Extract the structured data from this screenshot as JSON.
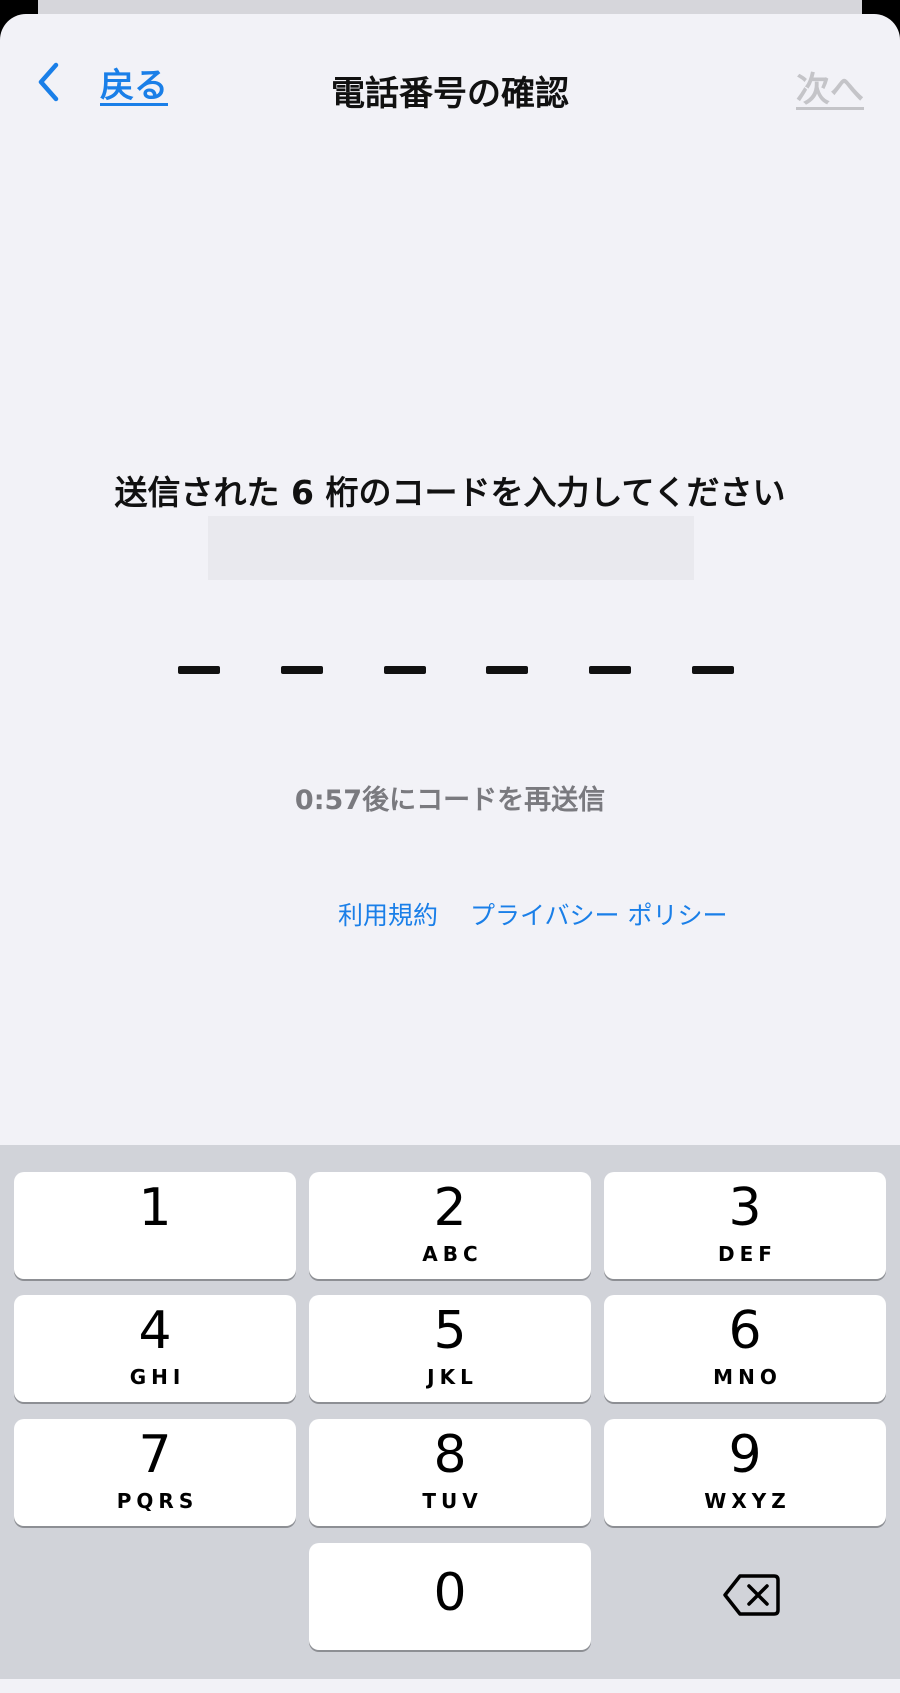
{
  "nav": {
    "back_label": "戻る",
    "title": "電話番号の確認",
    "next_label": "次へ"
  },
  "verification": {
    "instruction": "送信された 6 桁のコードを入力してください",
    "code_length": 6,
    "resend_text": "0:57後にコードを再送信"
  },
  "links": {
    "terms": "利用規約",
    "privacy": "プライバシー ポリシー"
  },
  "keypad": {
    "keys": [
      {
        "digit": "1",
        "letters": ""
      },
      {
        "digit": "2",
        "letters": "ABC"
      },
      {
        "digit": "3",
        "letters": "DEF"
      },
      {
        "digit": "4",
        "letters": "GHI"
      },
      {
        "digit": "5",
        "letters": "JKL"
      },
      {
        "digit": "6",
        "letters": "MNO"
      },
      {
        "digit": "7",
        "letters": "PQRS"
      },
      {
        "digit": "8",
        "letters": "TUV"
      },
      {
        "digit": "9",
        "letters": "WXYZ"
      },
      {
        "digit": "0",
        "letters": ""
      }
    ]
  },
  "icons": {
    "back": "chevron-left-icon",
    "delete": "backspace-icon"
  },
  "colors": {
    "accent": "#1a7fe8",
    "disabled": "#c4c4c8",
    "keypad_bg": "#d1d3d9",
    "sheet_bg": "#f2f2f7"
  }
}
